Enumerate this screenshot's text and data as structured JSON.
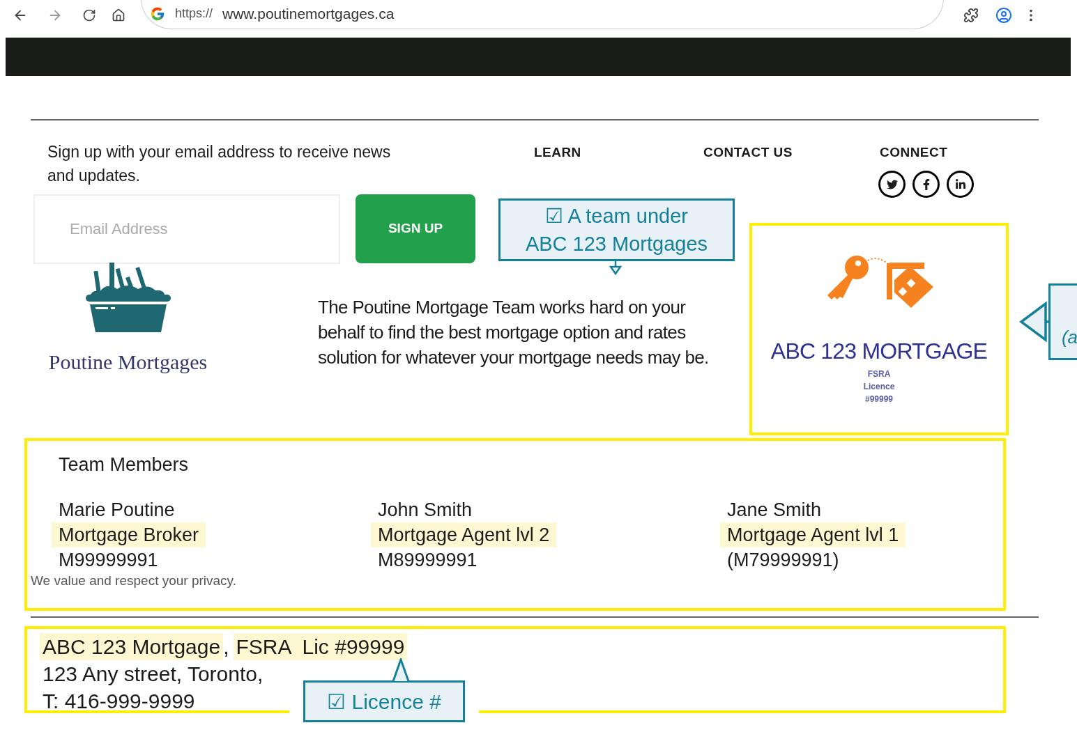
{
  "browser": {
    "protocol": "https://",
    "url": "www.poutinemortgages.ca"
  },
  "signup": {
    "text": "Sign up with your email address to receive news and updates.",
    "placeholder": "Email Address",
    "button": "SIGN UP"
  },
  "footer_links": [
    "LEARN",
    "CONTACT US",
    "CONNECT"
  ],
  "brand": {
    "name": "Poutine Mortgages"
  },
  "description": "The Poutine Mortgage Team works hard on your behalf to find the best mortgage option and rates solution for whatever your mortgage needs may be.",
  "partner_logo": {
    "name": "ABC 123 MORTGAGE",
    "lines": [
      "FSRA",
      "Licence",
      "#99999"
    ]
  },
  "team": {
    "title": "Team Members",
    "members": [
      {
        "name": "Marie Poutine",
        "role": "Mortgage Broker",
        "id": "M99999991"
      },
      {
        "name": "John Smith",
        "role": "Mortgage Agent lvl 2",
        "id": "M89999991"
      },
      {
        "name": "Jane Smith",
        "role": "Mortgage Agent lvl 1",
        "id": "(M79999991)"
      }
    ],
    "privacy": "We value and respect your privacy."
  },
  "company": {
    "name": "ABC 123 Mortgage",
    "separator": ",",
    "licence": "FSRA  Lic #99999",
    "address": "123 Any street, Toronto,",
    "phone": "T: 416-999-9999"
  },
  "annotations": [
    {
      "kind": "down",
      "lines": [
        "☑ A team under",
        "ABC 123 Mortgages"
      ]
    },
    {
      "kind": "up",
      "lines": [
        "☑ Licence #"
      ]
    },
    {
      "kind": "left",
      "lines": [
        "(a"
      ]
    }
  ]
}
